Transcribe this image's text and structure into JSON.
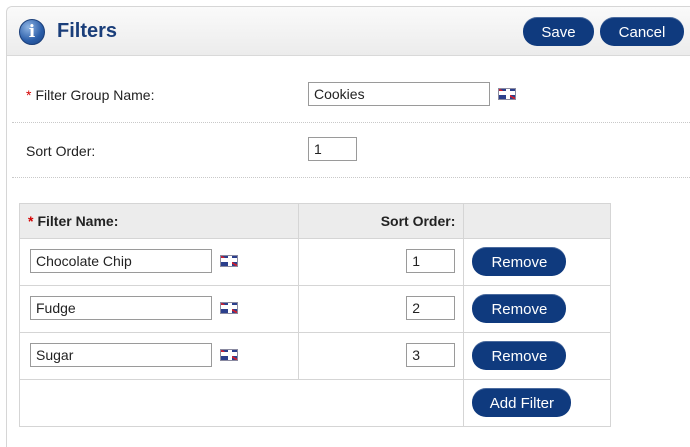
{
  "header": {
    "title": "Filters",
    "save_label": "Save",
    "cancel_label": "Cancel",
    "icon": "info-icon"
  },
  "form": {
    "required_mark": "*",
    "group_name_label": "Filter Group Name:",
    "group_name_value": "Cookies",
    "sort_order_label": "Sort Order:",
    "sort_order_value": "1"
  },
  "table": {
    "col_name": "Filter Name:",
    "col_sort": "Sort Order:",
    "rows": [
      {
        "name": "Chocolate Chip",
        "sort": "1",
        "remove_label": "Remove"
      },
      {
        "name": "Fudge",
        "sort": "2",
        "remove_label": "Remove"
      },
      {
        "name": "Sugar",
        "sort": "3",
        "remove_label": "Remove"
      }
    ],
    "add_label": "Add Filter"
  },
  "colors": {
    "button": "#0f3a7e",
    "title": "#1a3e7a",
    "required": "#d40000"
  }
}
